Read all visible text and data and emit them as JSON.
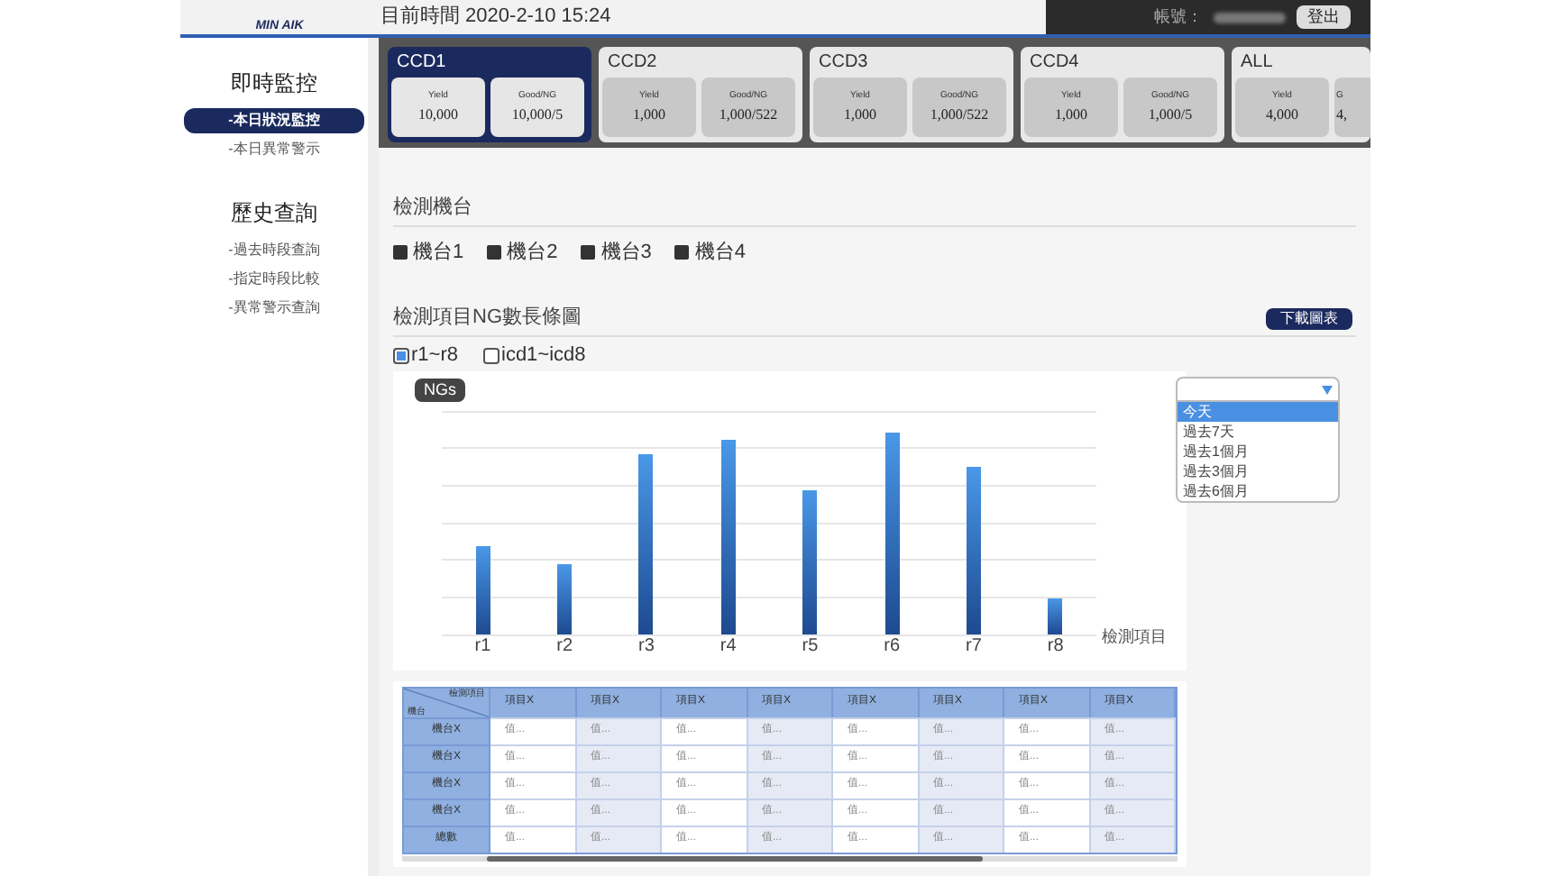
{
  "header": {
    "logo_text": "MIN AIK",
    "current_time": "目前時間 2020-2-10 15:24",
    "account_label": "帳號：",
    "logout_button": "登出"
  },
  "sidebar": {
    "sections": [
      {
        "title": "即時監控",
        "items": [
          {
            "label": "-本日狀況監控",
            "selected": true
          },
          {
            "label": "-本日異常警示",
            "selected": false
          }
        ]
      },
      {
        "title": "歷史查詢",
        "items": [
          {
            "label": "-過去時段查詢",
            "selected": false
          },
          {
            "label": "-指定時段比較",
            "selected": false
          },
          {
            "label": "-異常警示查詢",
            "selected": false
          }
        ]
      }
    ]
  },
  "ccd_tabs": [
    {
      "name": "CCD1",
      "selected": true,
      "metrics": [
        {
          "label": "Yield",
          "value": "10,000"
        },
        {
          "label": "Good/NG",
          "value": "10,000/5"
        }
      ]
    },
    {
      "name": "CCD2",
      "selected": false,
      "metrics": [
        {
          "label": "Yield",
          "value": "1,000"
        },
        {
          "label": "Good/NG",
          "value": "1,000/522"
        }
      ]
    },
    {
      "name": "CCD3",
      "selected": false,
      "metrics": [
        {
          "label": "Yield",
          "value": "1,000"
        },
        {
          "label": "Good/NG",
          "value": "1,000/522"
        }
      ]
    },
    {
      "name": "CCD4",
      "selected": false,
      "metrics": [
        {
          "label": "Yield",
          "value": "1,000"
        },
        {
          "label": "Good/NG",
          "value": "1,000/5"
        }
      ]
    },
    {
      "name": "ALL",
      "selected": false,
      "metrics": [
        {
          "label": "Yield",
          "value": "4,000"
        },
        {
          "label": "G",
          "value": "4,"
        }
      ]
    }
  ],
  "machines": {
    "title": "檢測機台",
    "items": [
      {
        "label": "機台1",
        "checked": true
      },
      {
        "label": "機台2",
        "checked": true
      },
      {
        "label": "機台3",
        "checked": true
      },
      {
        "label": "機台4",
        "checked": true
      }
    ]
  },
  "ng_chart": {
    "title": "檢測項目NG數長條圖",
    "download_button": "下載圖表",
    "series_options": [
      {
        "label": "r1~r8",
        "checked": true
      },
      {
        "label": "icd1~icd8",
        "checked": false
      }
    ],
    "period_options": [
      {
        "label": "今天",
        "selected": true
      },
      {
        "label": "過去7天",
        "selected": false
      },
      {
        "label": "過去1個月",
        "selected": false
      },
      {
        "label": "過去3個月",
        "selected": false
      },
      {
        "label": "過去6個月",
        "selected": false
      }
    ],
    "legend": "NGs",
    "categories": [
      "r1",
      "r2",
      "r3",
      "r4",
      "r5",
      "r6",
      "r7",
      "r8"
    ],
    "xlabel": "檢測項目"
  },
  "table": {
    "corner_top": "檢測項目",
    "corner_bottom": "機台",
    "columns": [
      "項目X",
      "項目X",
      "項目X",
      "項目X",
      "項目X",
      "項目X",
      "項目X",
      "項目X"
    ],
    "rows": [
      {
        "label": "機台X",
        "cells": [
          "值...",
          "值...",
          "值...",
          "值...",
          "值...",
          "值...",
          "值...",
          "值..."
        ]
      },
      {
        "label": "機台X",
        "cells": [
          "值...",
          "值...",
          "值...",
          "值...",
          "值...",
          "值...",
          "值...",
          "值..."
        ]
      },
      {
        "label": "機台X",
        "cells": [
          "值...",
          "值...",
          "值...",
          "值...",
          "值...",
          "值...",
          "值...",
          "值..."
        ]
      },
      {
        "label": "機台X",
        "cells": [
          "值...",
          "值...",
          "值...",
          "值...",
          "值...",
          "值...",
          "值...",
          "值..."
        ]
      },
      {
        "label": "總數",
        "cells": [
          "值...",
          "值...",
          "值...",
          "值...",
          "值...",
          "值...",
          "值...",
          "值..."
        ]
      }
    ]
  }
}
